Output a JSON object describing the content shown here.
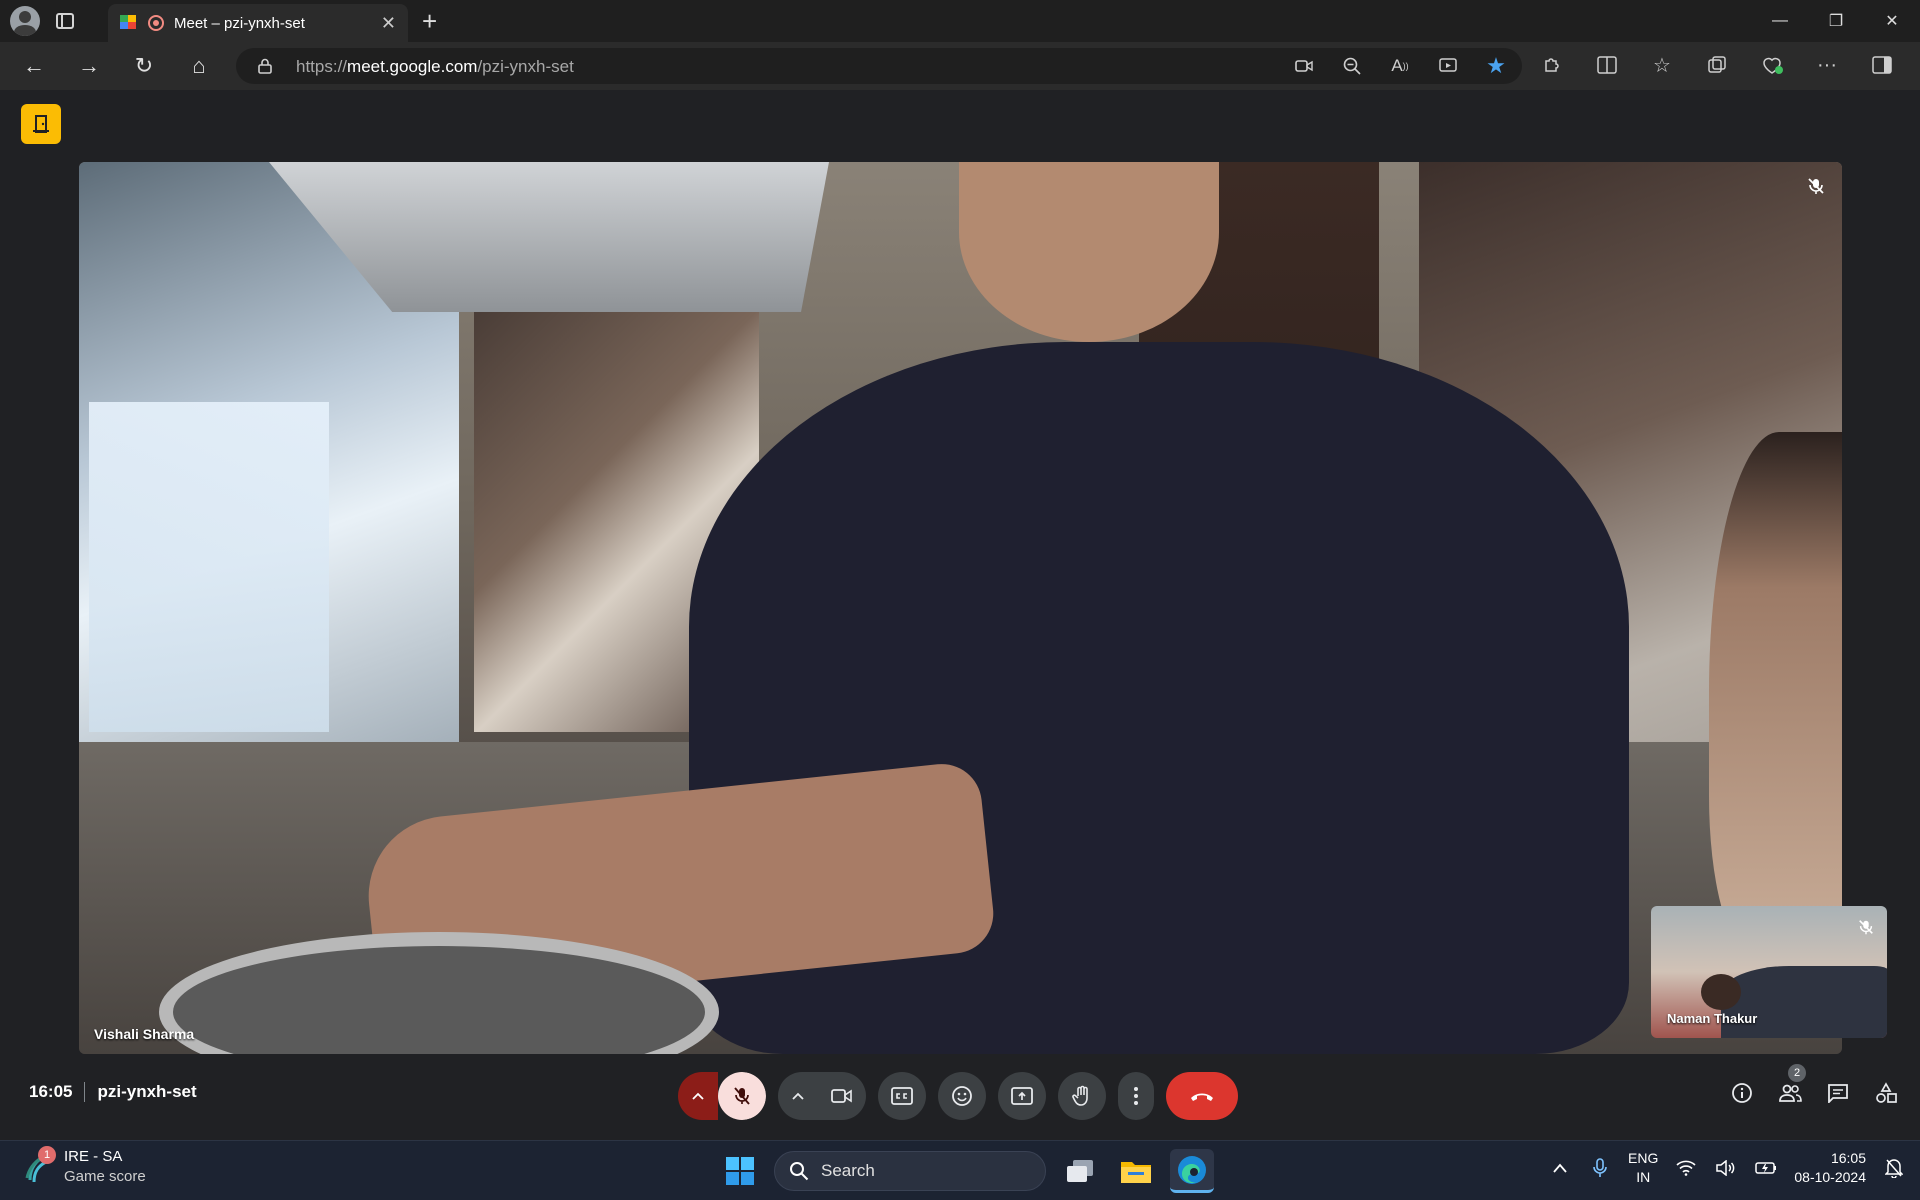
{
  "browser": {
    "tab_title": "Meet – pzi-ynxh-set",
    "url_prefix": "https://",
    "url_domain": "meet.google.com",
    "url_path": "/pzi-ynxh-set"
  },
  "meet": {
    "main_participant": "Vishali Sharma",
    "pip_participant": "Naman Thakur",
    "time": "16:05",
    "meeting_code": "pzi-ynxh-set",
    "participant_count": "2",
    "colors": {
      "end_call": "#dc362e",
      "mic_off_bg": "#f9dedc",
      "door_button": "#fbbc04"
    }
  },
  "taskbar": {
    "widget_title": "IRE - SA",
    "widget_sub": "Game score",
    "widget_badge": "1",
    "search_label": "Search",
    "lang_line1": "ENG",
    "lang_line2": "IN",
    "clock_time": "16:05",
    "clock_date": "08-10-2024"
  }
}
